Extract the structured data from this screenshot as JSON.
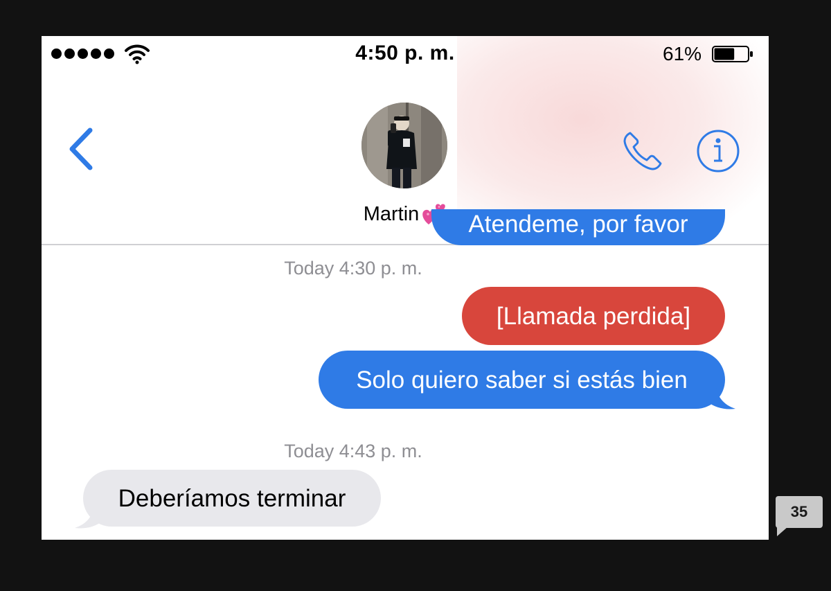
{
  "status_bar": {
    "time": "4:50 p. m.",
    "battery_percent": "61%",
    "battery_level": 0.61,
    "signal_bars": 5
  },
  "nav": {
    "back_icon": "chevron-left-icon",
    "contact_name": "Martin",
    "contact_emoji": "two-hearts",
    "call_icon": "phone-icon",
    "info_icon": "info-icon",
    "accent_color": "#2f7be6"
  },
  "messages": [
    {
      "type": "sent",
      "text": "Atendeme, por favor"
    },
    {
      "type": "timestamp",
      "text": "Today 4:30 p. m."
    },
    {
      "type": "missed",
      "text": "[Llamada perdida]"
    },
    {
      "type": "sent",
      "text": "Solo quiero saber si estás bien"
    },
    {
      "type": "timestamp",
      "text": "Today 4:43 p. m."
    },
    {
      "type": "received",
      "text": "Deberíamos terminar"
    }
  ],
  "colors": {
    "sent": "#2f7be6",
    "missed": "#d8463c",
    "received": "#e8e8ec",
    "timestamp": "#8e8e93"
  },
  "page_badge": "35"
}
